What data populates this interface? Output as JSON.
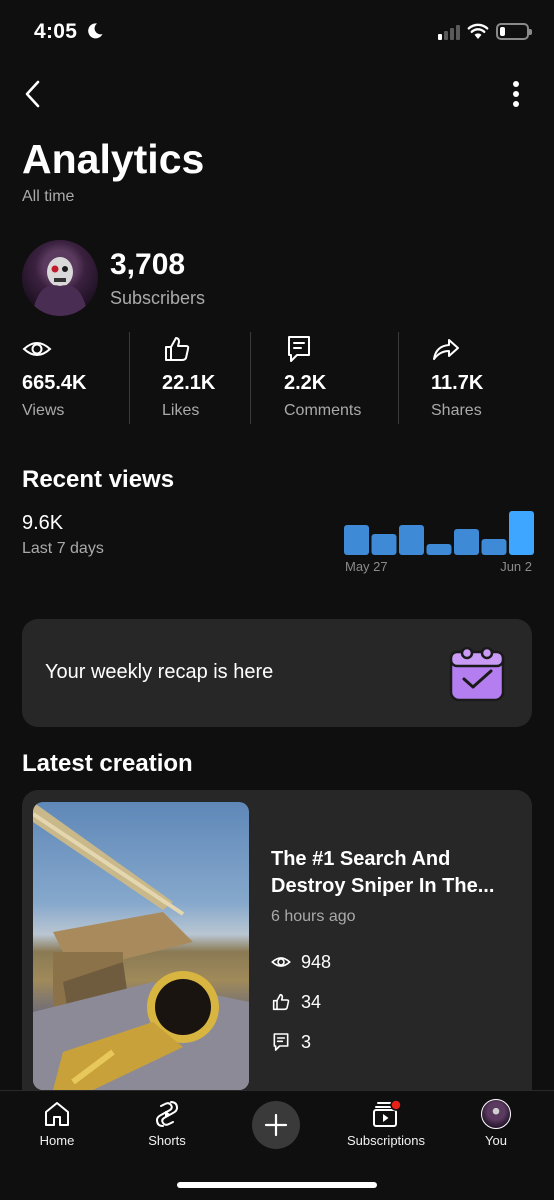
{
  "status_bar": {
    "time": "4:05"
  },
  "header": {
    "title": "Analytics",
    "subtitle": "All time"
  },
  "subscribers": {
    "count": "3,708",
    "label": "Subscribers"
  },
  "stats": [
    {
      "value": "665.4K",
      "label": "Views",
      "icon": "eye-icon"
    },
    {
      "value": "22.1K",
      "label": "Likes",
      "icon": "thumbs-up-icon"
    },
    {
      "value": "2.2K",
      "label": "Comments",
      "icon": "comment-icon"
    },
    {
      "value": "11.7K",
      "label": "Shares",
      "icon": "share-icon"
    }
  ],
  "recent_views": {
    "title": "Recent views",
    "value": "9.6K",
    "period": "Last 7 days",
    "chart_start_label": "May 27",
    "chart_end_label": "Jun 2"
  },
  "chart_data": {
    "type": "bar",
    "categories": [
      "May 27",
      "",
      "",
      "",
      "",
      "",
      "Jun 2"
    ],
    "values": [
      30,
      21,
      30,
      11,
      26,
      16,
      44
    ],
    "highlight_index": 6,
    "colors": {
      "bar": "#3e8ad6",
      "highlight": "#3ea6ff"
    }
  },
  "recap": {
    "text": "Your weekly recap is here",
    "icon": "calendar-check-icon",
    "icon_color": "#c58af9"
  },
  "latest": {
    "title": "Latest creation",
    "video_title": "The #1 Search And Destroy Sniper In The...",
    "time": "6 hours ago",
    "views": "948",
    "likes": "34",
    "comments": "3"
  },
  "nav": {
    "home": "Home",
    "shorts": "Shorts",
    "subscriptions": "Subscriptions",
    "you": "You"
  }
}
